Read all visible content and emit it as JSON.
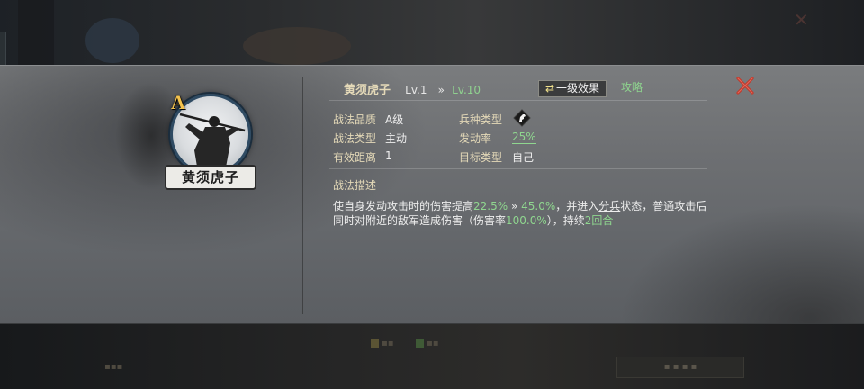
{
  "tactic": {
    "name": "黄须虎子",
    "level_current": "Lv.1",
    "level_arrow": "»",
    "level_max": "Lv.10",
    "grade": "A",
    "level_button": "一级效果",
    "level_button_icon": "swap-arrows-icon",
    "guide_link": "攻略"
  },
  "attributes": {
    "quality_label": "战法品质",
    "quality_value": "A级",
    "troop_label": "兵种类型",
    "troop_icon": "cavalry-horse-icon",
    "type_label": "战法类型",
    "type_value": "主动",
    "rate_label": "发动率",
    "rate_value": "25%",
    "range_label": "有效距离",
    "range_value": "1",
    "target_label": "目标类型",
    "target_value": "自己"
  },
  "description": {
    "title": "战法描述",
    "segments": [
      {
        "text": "使自身发动攻击时的伤害提高",
        "style": ""
      },
      {
        "text": "22.5%",
        "style": "hl"
      },
      {
        "text": " » ",
        "style": ""
      },
      {
        "text": "45.0%",
        "style": "hl"
      },
      {
        "text": "，并进入",
        "style": ""
      },
      {
        "text": "分兵",
        "style": "ul"
      },
      {
        "text": "状态，普通攻击后同时对附近的敌军造成伤害（伤害率",
        "style": ""
      },
      {
        "text": "100.0%",
        "style": "hl"
      },
      {
        "text": "），持续",
        "style": ""
      },
      {
        "text": "2回合",
        "style": "hl"
      }
    ]
  },
  "colors": {
    "label_gold": "#e4d9b8",
    "value_green": "#8fd68f",
    "close_red": "#c0392b",
    "grade_gold": "#f3c24d"
  }
}
